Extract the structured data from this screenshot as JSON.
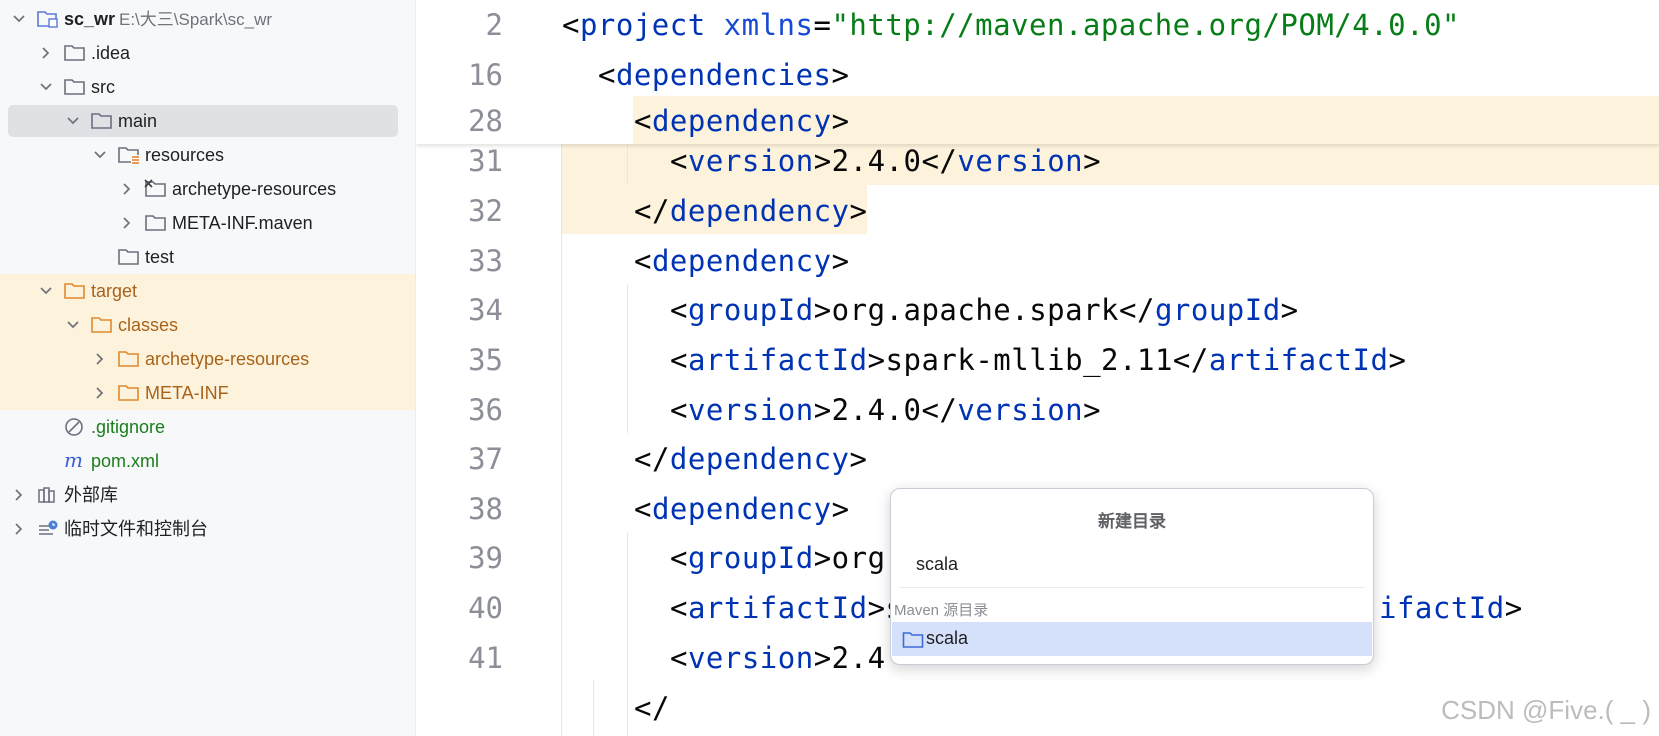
{
  "project_tree": {
    "root": {
      "name": "sc_wr",
      "path": "E:\\大三\\Spark\\sc_wr"
    },
    "items": [
      {
        "label": ".idea"
      },
      {
        "label": "src"
      },
      {
        "label": "main"
      },
      {
        "label": "resources"
      },
      {
        "label": "archetype-resources"
      },
      {
        "label": "META-INF.maven"
      },
      {
        "label": "test"
      },
      {
        "label": "target"
      },
      {
        "label": "classes"
      },
      {
        "label": "archetype-resources"
      },
      {
        "label": "META-INF"
      },
      {
        "label": ".gitignore"
      },
      {
        "label": "pom.xml"
      },
      {
        "label": "外部库"
      },
      {
        "label": "临时文件和控制台"
      }
    ]
  },
  "editor": {
    "line_numbers": [
      "2",
      "16",
      "28",
      "31",
      "32",
      "33",
      "34",
      "35",
      "36",
      "37",
      "38",
      "39",
      "40",
      "41"
    ],
    "code": {
      "l2_tag": "project",
      "l2_attr": "xmlns",
      "l2_val": "\"http://maven.apache.org/POM/4.0.0\"",
      "dependencies": "dependencies",
      "dependency": "dependency",
      "version": "version",
      "groupId": "groupId",
      "artifactId": "artifactId",
      "v240": "2.4.0",
      "org_apache_spark": "org.apache.spark",
      "spark_mllib": "spark-mllib_2.11",
      "org_partial": "org",
      "ifactId_partial": "ifactId",
      "v24_partial": "2.4",
      "s_partial": "s"
    }
  },
  "popup": {
    "title": "新建目录",
    "input_value": "scala",
    "section_label": "Maven 源目录",
    "item_label": "scala"
  },
  "watermark": "CSDN @Five.(  _  )",
  "colors": {
    "tag": "#0033b3",
    "attr": "#174ad4",
    "string": "#067d17",
    "highlight_row": "#fdf2dc",
    "selection": "#d5e1fb"
  }
}
